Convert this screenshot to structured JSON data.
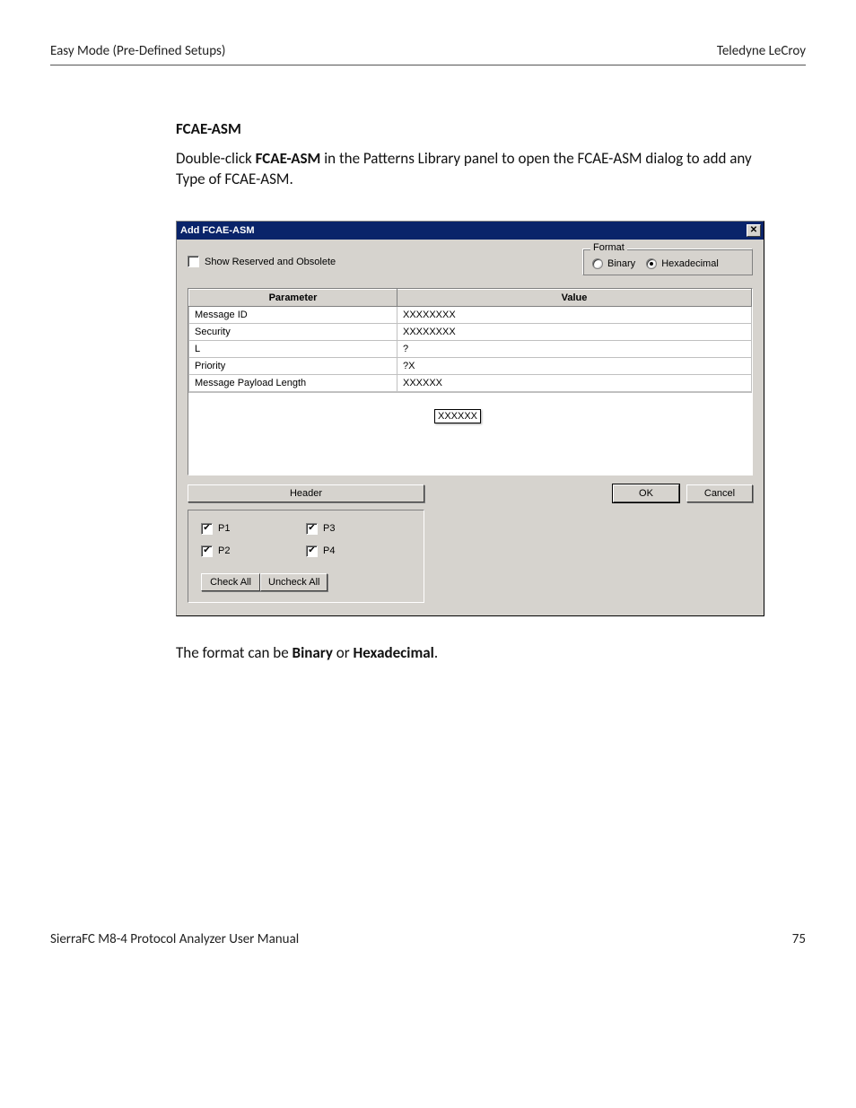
{
  "page": {
    "header_left": "Easy Mode (Pre-Defined Setups)",
    "header_right": "Teledyne  LeCroy",
    "footer_left": "SierraFC M8-4 Protocol Analyzer User Manual",
    "footer_right": "75"
  },
  "section": {
    "title": "FCAE-ASM",
    "intro_pre": "Double-click ",
    "intro_bold": "FCAE-ASM",
    "intro_post": " in the Patterns Library panel to open the FCAE-ASM dialog to add any Type of FCAE-ASM.",
    "caption_pre": "The format can be ",
    "caption_b1": "Binary",
    "caption_mid": " or ",
    "caption_b2": "Hexadecimal",
    "caption_post": "."
  },
  "dialog": {
    "title": "Add FCAE-ASM",
    "show_reserved": "Show Reserved and Obsolete",
    "format": {
      "legend": "Format",
      "binary": "Binary",
      "hex": "Hexadecimal",
      "selected": "hex"
    },
    "table": {
      "col_param": "Parameter",
      "col_value": "Value",
      "rows": [
        {
          "param": "Message ID",
          "value": "XXXXXXXX"
        },
        {
          "param": "Security",
          "value": "XXXXXXXX"
        },
        {
          "param": "L",
          "value": "?"
        },
        {
          "param": "Priority",
          "value": "?X"
        },
        {
          "param": "Message Payload Length",
          "value": "XXXXXX"
        }
      ]
    },
    "edit_value": "XXXXXX",
    "buttons": {
      "header": "Header",
      "ok": "OK",
      "cancel": "Cancel",
      "check_all": "Check All",
      "uncheck_all": "Uncheck All"
    },
    "ports": {
      "p1": "P1",
      "p2": "P2",
      "p3": "P3",
      "p4": "P4"
    }
  }
}
